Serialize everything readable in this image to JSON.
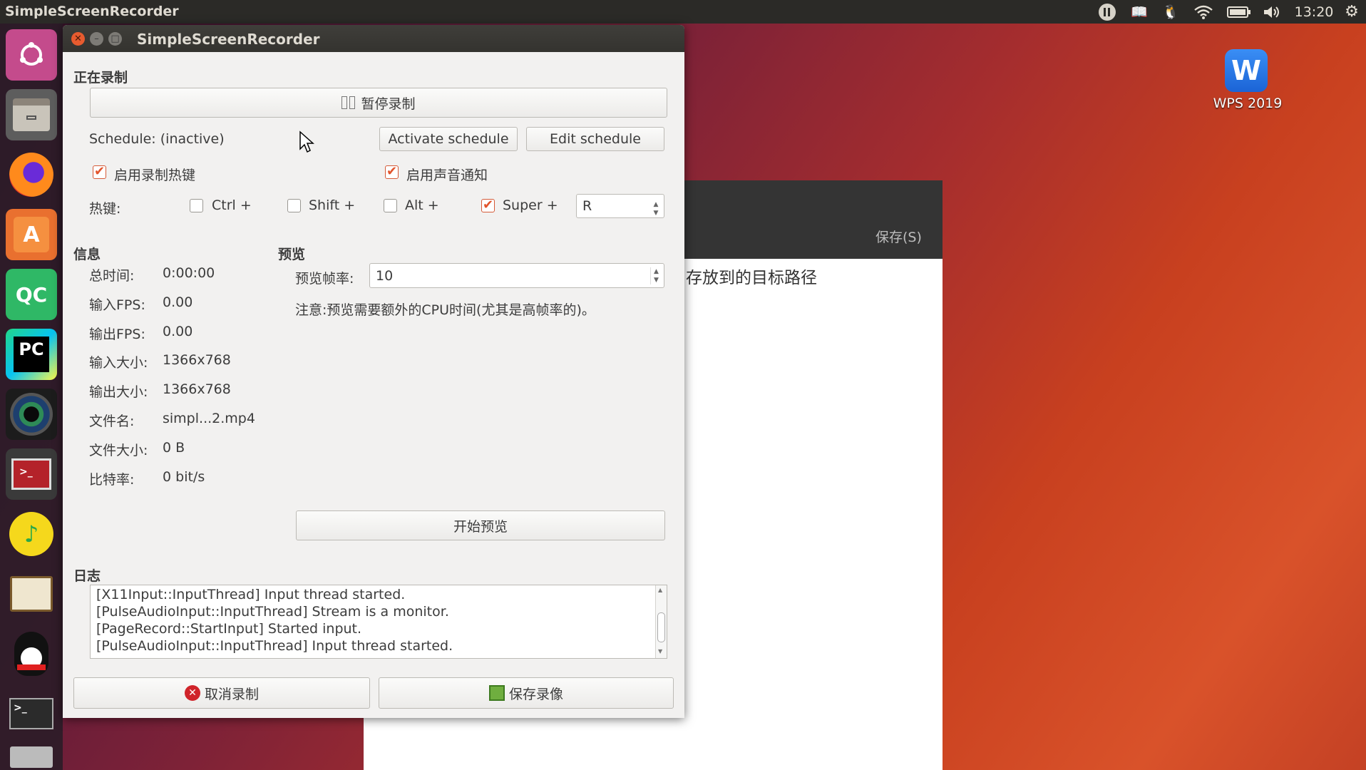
{
  "topbar": {
    "app_title": "SimpleScreenRecorder",
    "clock": "13:20",
    "icons": [
      "pause-indicator-icon",
      "book-icon",
      "tux-icon",
      "wifi-icon",
      "battery-icon",
      "volume-icon",
      "gear-icon"
    ]
  },
  "launcher": {
    "items": [
      "ubuntu-dash",
      "files",
      "firefox",
      "software-center",
      "qc",
      "pycharm",
      "camera",
      "terminal-app",
      "music-player",
      "ebook-reader",
      "qq",
      "terminal",
      "printer"
    ],
    "qc_label": "QC",
    "pc_label": "PC"
  },
  "desktop": {
    "wps_label": "WPS 2019"
  },
  "background_window": {
    "save_label": "保存(S)",
    "text": "存放到的目标路径"
  },
  "window": {
    "title": "SimpleScreenRecorder",
    "recording_header": "正在录制",
    "pause_button": "暂停录制",
    "schedule_status": "Schedule: (inactive)",
    "activate_schedule": "Activate schedule",
    "edit_schedule": "Edit schedule",
    "enable_hotkey": "启用录制热键",
    "enable_hotkey_checked": true,
    "enable_sound": "启用声音通知",
    "enable_sound_checked": true,
    "hotkey_label": "热键:",
    "ctrl": "Ctrl +",
    "shift": "Shift +",
    "alt": "Alt +",
    "super": "Super +",
    "ctrl_checked": false,
    "shift_checked": false,
    "alt_checked": false,
    "super_checked": true,
    "hotkey_key": "R",
    "info_header": "信息",
    "preview_header": "预览",
    "info": [
      {
        "label": "总时间:",
        "value": "0:00:00"
      },
      {
        "label": "输入FPS:",
        "value": "0.00"
      },
      {
        "label": "输出FPS:",
        "value": "0.00"
      },
      {
        "label": "输入大小:",
        "value": "1366x768"
      },
      {
        "label": "输出大小:",
        "value": "1366x768"
      },
      {
        "label": "文件名:",
        "value": "simpl...2.mp4"
      },
      {
        "label": "文件大小:",
        "value": "0 B"
      },
      {
        "label": "比特率:",
        "value": "0 bit/s"
      }
    ],
    "preview_fps_label": "预览帧率:",
    "preview_fps_value": "10",
    "preview_note": "注意:预览需要额外的CPU时间(尤其是高帧率的)。",
    "start_preview": "开始预览",
    "log_header": "日志",
    "log": [
      "[X11Input::InputThread] Input thread started.",
      "[PulseAudioInput::InputThread] Stream is a monitor.",
      "[PageRecord::StartInput] Started input.",
      "[PulseAudioInput::InputThread] Input thread started."
    ],
    "cancel_button": "取消录制",
    "save_button": "保存录像"
  }
}
